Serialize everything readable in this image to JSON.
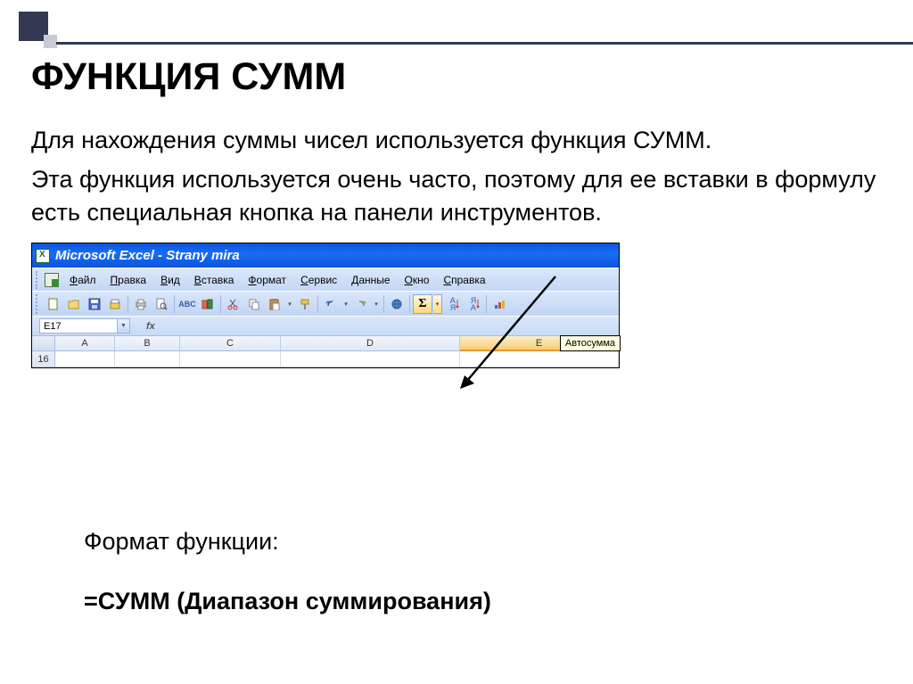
{
  "slide": {
    "title": "ФУНКЦИЯ СУММ",
    "intro_line1": "Для нахождения суммы чисел используется функция СУММ.",
    "intro_line2": "Эта функция используется очень часто, поэтому для ее вставки в формулу есть специальная кнопка на панели инструментов.",
    "format_label": "Формат функции:",
    "format_syntax": "=СУММ (Диапазон суммирования)"
  },
  "excel": {
    "app_title": "Microsoft Excel - Strany mira",
    "menu": {
      "file": "Файл",
      "edit": "Правка",
      "view": "Вид",
      "insert": "Вставка",
      "format": "Формат",
      "tools": "Сервис",
      "data": "Данные",
      "window": "Окно",
      "help": "Справка"
    },
    "tooltip_autosum": "Автосумма",
    "namebox_value": "E17",
    "fx_label": "fx",
    "sigma_symbol": "Σ",
    "columns": {
      "A": "A",
      "B": "B",
      "C": "C",
      "D": "D",
      "E": "E"
    },
    "row_number": "16"
  }
}
